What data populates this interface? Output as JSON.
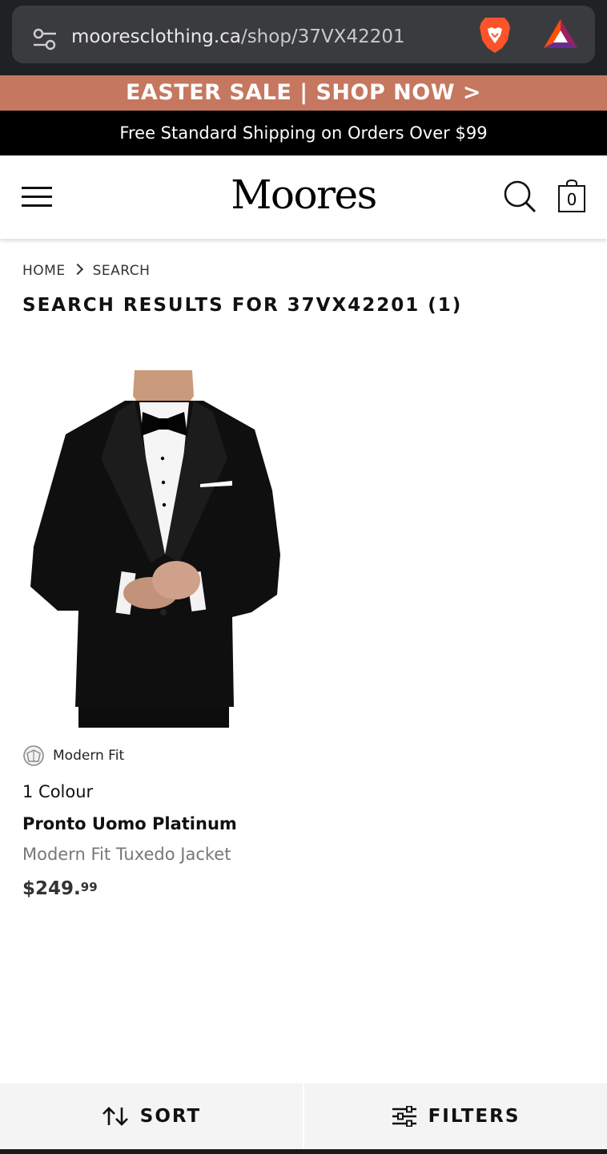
{
  "browser": {
    "url_host": "mooresclothing.ca",
    "url_path": "/shop/37VX42201",
    "site_settings_icon": "tune-icon",
    "shield_icon": "brave-lion-icon",
    "rewards_icon": "bat-triangle-icon"
  },
  "promo": {
    "text": "EASTER SALE | SHOP NOW >",
    "background": "#c6775f"
  },
  "shipping": {
    "text": "Free Standard Shipping on Orders Over $99"
  },
  "header": {
    "logo": "Moores",
    "menu_icon": "hamburger-menu-icon",
    "search_icon": "search-icon",
    "cart_icon": "shopping-bag-icon",
    "cart_count": "0"
  },
  "breadcrumb": {
    "items": [
      "HOME",
      "SEARCH"
    ]
  },
  "page": {
    "title": "SEARCH RESULTS FOR 37VX42201 (1)"
  },
  "product": {
    "image_alt": "tuxedo-jacket-photo",
    "fit_icon": "hanger-fit-icon",
    "fit": "Modern Fit",
    "colours": "1 Colour",
    "brand": "Pronto Uomo Platinum",
    "description": "Modern Fit Tuxedo Jacket",
    "price_main": "$249.",
    "price_cents": "99"
  },
  "bottom_bar": {
    "sort_label": "SORT",
    "sort_icon": "sort-arrows-icon",
    "filters_label": "FILTERS",
    "filters_icon": "sliders-icon"
  }
}
